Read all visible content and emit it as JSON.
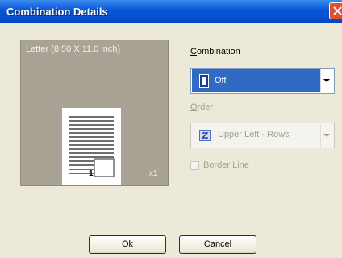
{
  "window": {
    "title": "Combination Details"
  },
  "preview": {
    "paper_label": "Letter  (8.50 X 11.0 inch)",
    "page_number": "1",
    "count_label": "x1"
  },
  "combination": {
    "label_mnemonic": "C",
    "label_rest": "ombination",
    "selected": "Off",
    "icon": "page-icon"
  },
  "order": {
    "label_mnemonic": "O",
    "label_rest": "rder",
    "selected": "Upper Left - Rows",
    "icon": "z-order-icon",
    "enabled": false
  },
  "border_line": {
    "label_mnemonic": "B",
    "label_rest": "order Line",
    "checked": false,
    "enabled": false
  },
  "buttons": {
    "ok_mnemonic": "O",
    "ok_rest": "k",
    "cancel_mnemonic": "C",
    "cancel_rest": "ancel"
  },
  "colors": {
    "titlebar": "#0a56d8",
    "selection": "#316ac5",
    "preview_bg": "#a8a394",
    "disabled_text": "#a1a192"
  }
}
